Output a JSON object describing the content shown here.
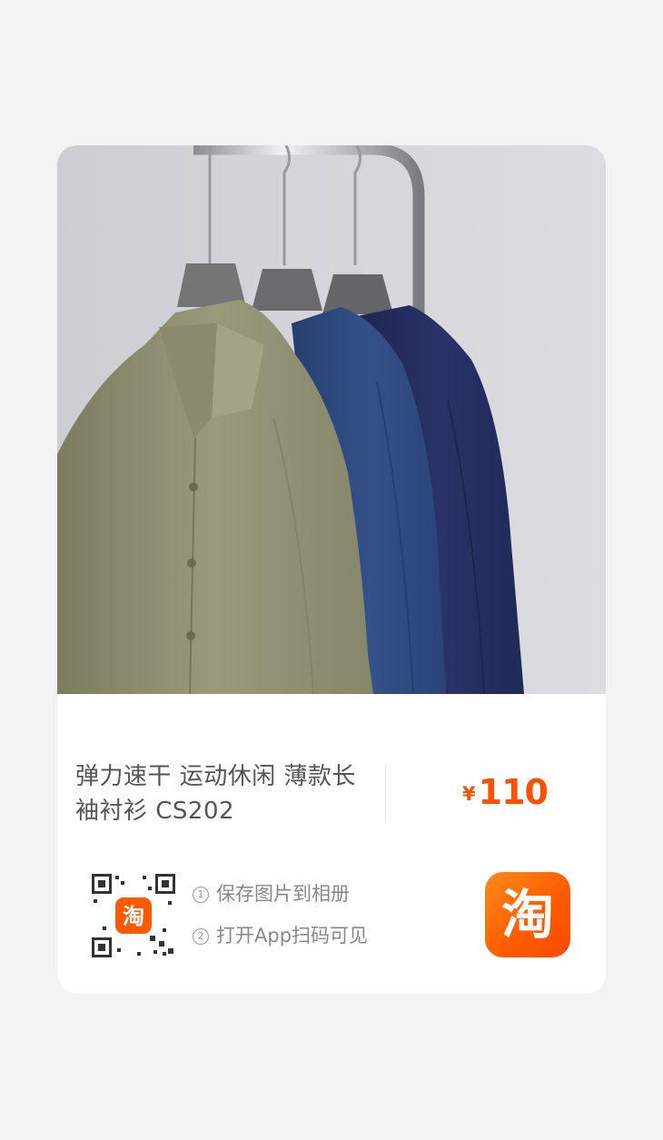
{
  "product": {
    "title": "弹力速干 运动休闲 薄款长袖衬衫 CS202",
    "currency": "¥",
    "price": "110",
    "image": "product-photo-shirts-on-hanger"
  },
  "share": {
    "step1_num": "①",
    "step1": "保存图片到相册",
    "step2_num": "②",
    "step2": "打开App扫码可见",
    "qr_center_glyph": "淘",
    "app_icon_glyph": "淘"
  },
  "colors": {
    "accent": "#ff5000",
    "background": "#f3f3f3",
    "card": "#ffffff"
  }
}
